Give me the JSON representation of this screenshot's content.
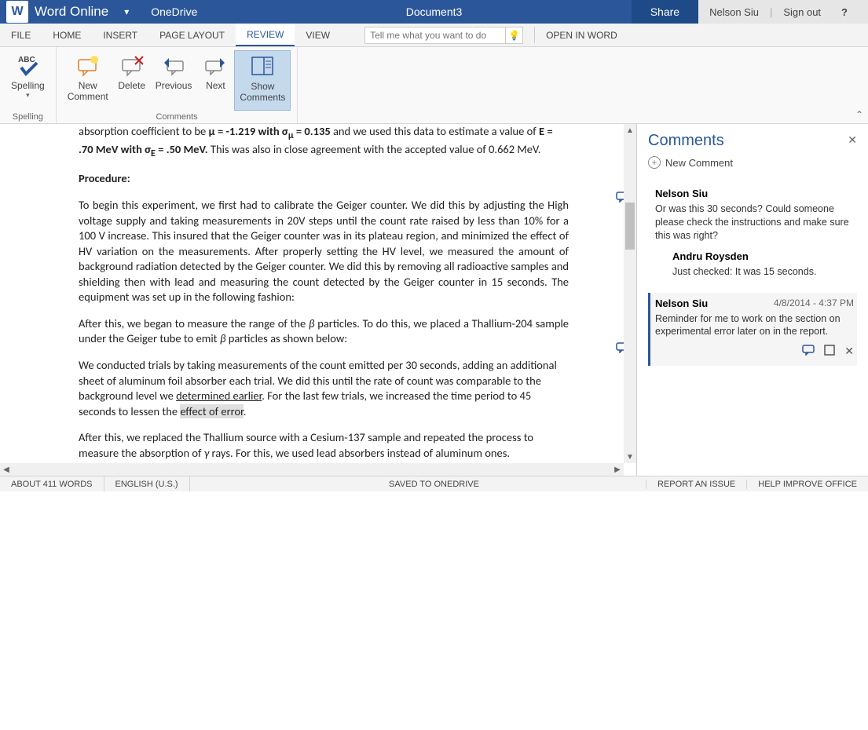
{
  "app": {
    "name": "Word Online",
    "breadcrumb": "OneDrive",
    "doc_title": "Document3"
  },
  "titlebar": {
    "share": "Share",
    "user": "Nelson Siu",
    "signout": "Sign out",
    "help": "?"
  },
  "tabs": {
    "file": "FILE",
    "home": "HOME",
    "insert": "INSERT",
    "page_layout": "PAGE LAYOUT",
    "review": "REVIEW",
    "view": "VIEW",
    "tellme_placeholder": "Tell me what you want to do",
    "open_in_word": "OPEN IN WORD"
  },
  "ribbon": {
    "spelling": "Spelling",
    "spelling_group": "Spelling",
    "new_comment": "New\nComment",
    "delete": "Delete",
    "previous": "Previous",
    "next": "Next",
    "show_comments": "Show\nComments",
    "comments_group": "Comments"
  },
  "document": {
    "p1_a": "absorption coefficient to be ",
    "p1_b": "μ = -1.219 with σ",
    "p1_sub1": "μ",
    "p1_c": " = 0.135",
    "p1_d": " and we used this data to estimate a value of ",
    "p1_e": "E = .70 MeV with σ",
    "p1_sub2": "E",
    "p1_f": " = .50 MeV.",
    "p1_g": " This was also in close agreement with the accepted value of 0.662 MeV.",
    "h_procedure": "Procedure:",
    "p2": "To begin this experiment, we first had to calibrate the Geiger counter. We did this by adjusting the High voltage supply and taking measurements in 20V steps until the count rate raised by less than 10% for a 100 V increase. This insured that the Geiger counter was in its plateau region, and minimized the effect of HV variation on the measurements. After properly setting the HV level, we measured the amount of background radiation detected by the Geiger counter. We did this by removing all radioactive samples and shielding then with lead and measuring the count detected by the Geiger counter in 15 seconds. The equipment was set up in the following fashion:",
    "p3_a": "After this, we began to measure the range of the ",
    "p3_i1": "β",
    "p3_b": " particles. To do this, we placed a Thallium-204 sample under the Geiger tube to emit ",
    "p3_i2": "β",
    "p3_c": " particles as shown below:",
    "p4_a": "We conducted trials by taking measurements of the count emitted per 30 seconds, adding an additional sheet of aluminum foil absorber each trial. We did this until the rate of count was comparable to the background level we ",
    "p4_u": "determined earlier",
    "p4_b": ". For the last few trials, we increased the time period to 45 seconds to lessen the ",
    "p4_hl": "effect of error",
    "p4_c": ".",
    "p5_a": "After this, we replaced the Thallium source with a Cesium-137 sample and repeated the process to measure the absorption of ",
    "p5_i": "γ",
    "p5_b": " rays. For this, we used lead absorbers instead of aluminum ones."
  },
  "comments_pane": {
    "title": "Comments",
    "new_comment": "New Comment",
    "c1": {
      "author": "Nelson Siu",
      "body": "Or was this 30 seconds?  Could someone please check the instructions and make sure this was right?"
    },
    "c1r": {
      "author": "Andru Roysden",
      "body": "Just checked: It was 15 seconds."
    },
    "c2": {
      "author": "Nelson Siu",
      "ts": "4/8/2014 - 4:37 PM",
      "body": "Reminder for me to work on the section on experimental error later on in the report."
    }
  },
  "statusbar": {
    "words": "ABOUT 411 WORDS",
    "lang": "ENGLISH (U.S.)",
    "saved": "SAVED TO ONEDRIVE",
    "report": "REPORT AN ISSUE",
    "improve": "HELP IMPROVE OFFICE"
  }
}
